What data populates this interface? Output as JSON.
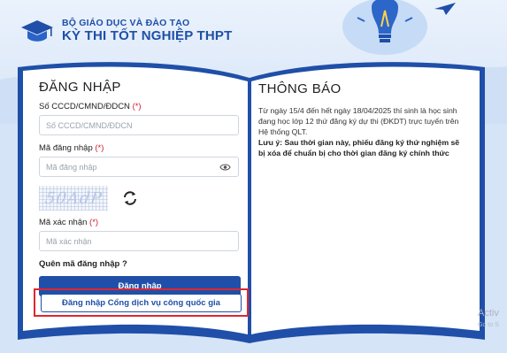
{
  "header": {
    "ministry": "BỘ GIÁO DỤC VÀ ĐÀO TẠO",
    "title": "KỲ THI TỐT NGHIỆP THPT"
  },
  "login": {
    "heading": "ĐĂNG NHẬP",
    "id_label": "Số CCCD/CMND/ĐDCN",
    "id_placeholder": "Số CCCD/CMND/ĐDCN",
    "password_label": "Mã đăng nhập",
    "password_placeholder": "Mã đăng nhập",
    "captcha_text": "50AdP",
    "captcha_label": "Mã xác nhận",
    "captcha_placeholder": "Mã xác nhận",
    "required_mark": "(*)",
    "forgot": "Quên mã đăng nhập ?",
    "submit": "Đăng nhập",
    "vneid": "Đăng nhập Cổng dịch vụ công quốc gia"
  },
  "notice": {
    "heading": "THÔNG BÁO",
    "body": "Từ ngày 15/4 đến hết ngày 18/04/2025 thí sinh là học sinh đang học lớp 12 thứ đăng ký dự thi (ĐKDT) trực tuyến trên Hệ thống QLT.",
    "warning": "Lưu ý: Sau thời gian này, phiếu đăng ký thứ nghiệm sẽ bị xóa để chuẩn bị cho thời gian đăng ký chính thức"
  },
  "watermark": {
    "line1": "Activ",
    "line2": "Go to S"
  },
  "colors": {
    "primary": "#1f4fa8",
    "required": "#d21c2a",
    "highlight_box": "#e0262e"
  }
}
